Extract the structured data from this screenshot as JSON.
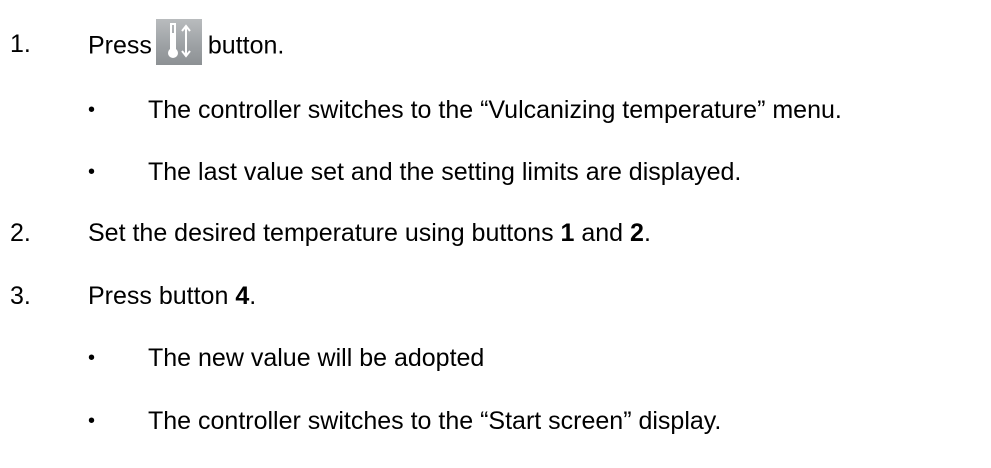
{
  "steps": [
    {
      "number": "1.",
      "before_icon": "Press",
      "icon": "thermometer-up-down-icon",
      "after_icon": "button.",
      "bullets": [
        "The controller switches to the “Vulcanizing temperature” menu.",
        "The last value set and the setting limits are displayed."
      ]
    },
    {
      "number": "2.",
      "text_a": "Set the desired temperature using buttons ",
      "bold_a": "1",
      "text_b": " and ",
      "bold_b": "2",
      "text_c": "."
    },
    {
      "number": "3.",
      "text_a": "Press button ",
      "bold_a": "4",
      "text_b": ".",
      "bullets": [
        "The new value will be adopted",
        "The controller switches to the “Start screen” display."
      ]
    }
  ],
  "bullet_glyph": "•",
  "colors": {
    "icon_bg": "#9ea2a5",
    "icon_fg": "#ffffff",
    "text": "#000000"
  }
}
